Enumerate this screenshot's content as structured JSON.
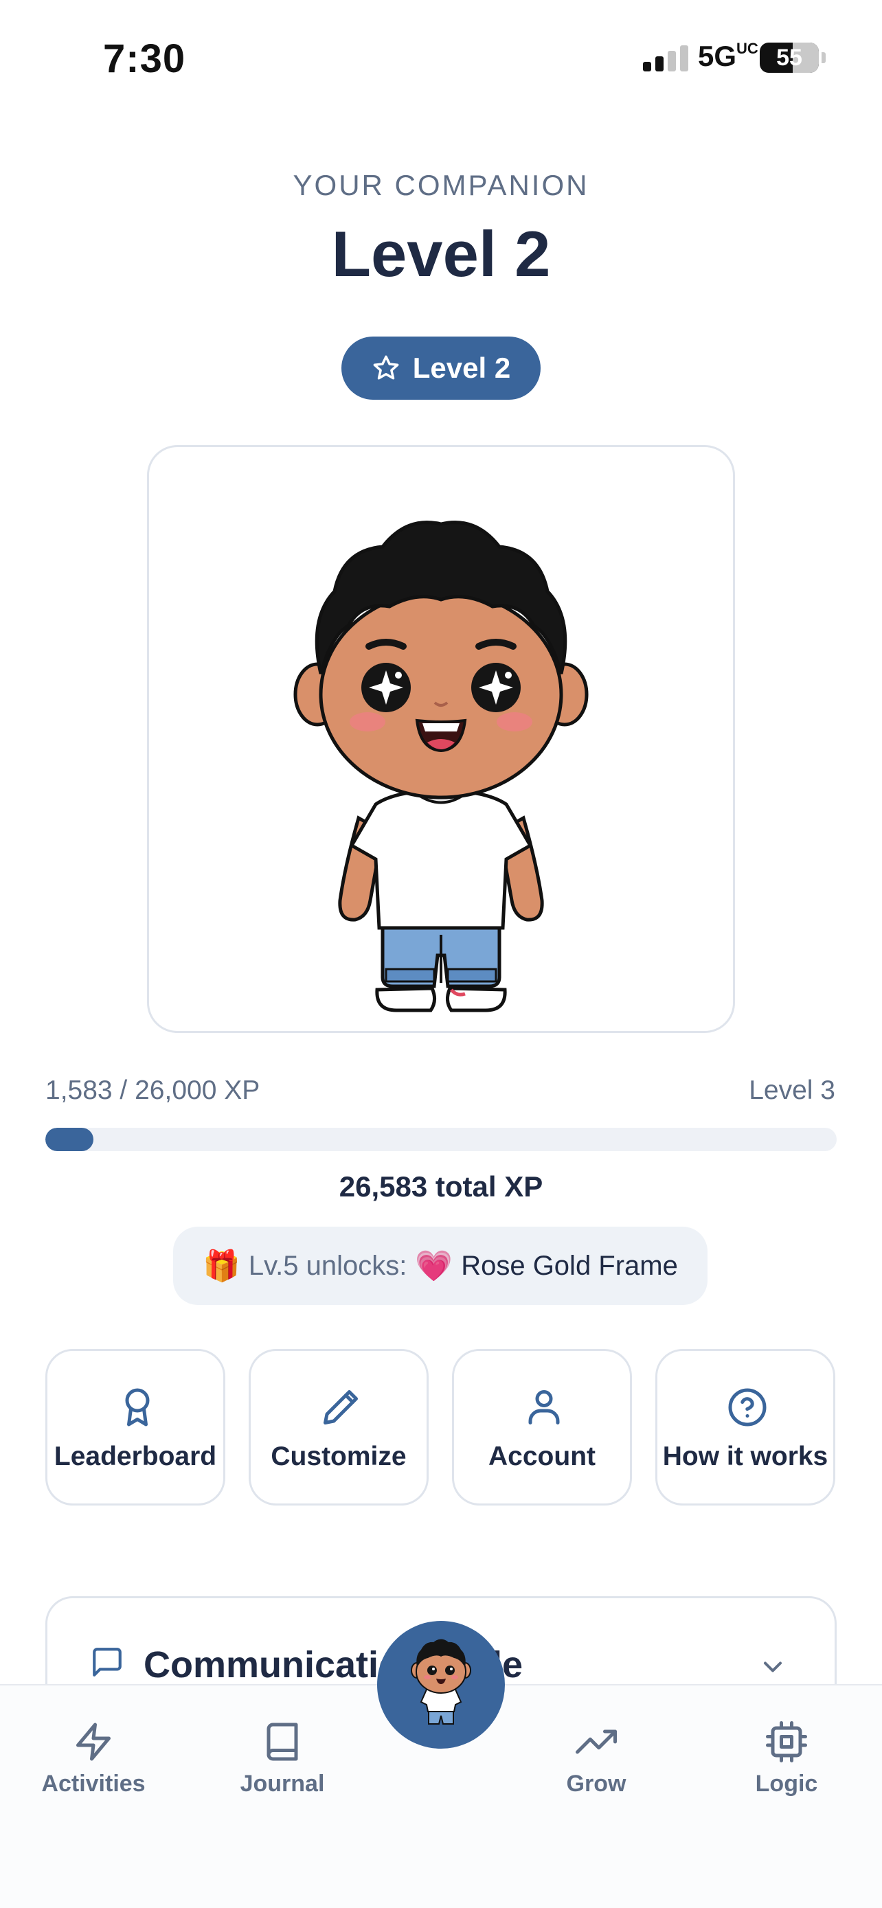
{
  "status_bar": {
    "time": "7:30",
    "network": "5G",
    "network_superscript": "UC",
    "battery_percent": "55"
  },
  "header": {
    "eyebrow": "YOUR COMPANION",
    "title": "Level 2",
    "level_badge": "Level 2"
  },
  "avatar": {
    "icon": "cartoon-boy-avatar"
  },
  "progress": {
    "current_label": "1,583 / 26,000 XP",
    "next_level_label": "Level 3",
    "fraction": 0.061,
    "total_label": "26,583 total XP"
  },
  "unlock": {
    "gift_emoji": "🎁",
    "label": "Lv.5 unlocks:",
    "heart_emoji": "💗",
    "reward": "Rose Gold Frame"
  },
  "actions": [
    {
      "label": "Leaderboard",
      "icon": "award-ribbon-icon"
    },
    {
      "label": "Customize",
      "icon": "pencil-icon"
    },
    {
      "label": "Account",
      "icon": "user-icon"
    },
    {
      "label": "How it works",
      "icon": "help-circle-icon"
    }
  ],
  "section": {
    "title": "Communication Style",
    "icon": "chat-bubble-icon"
  },
  "bottom_nav": [
    {
      "label": "Activities",
      "icon": "lightning-icon"
    },
    {
      "label": "Journal",
      "icon": "book-icon"
    },
    {
      "label": "Grow",
      "icon": "trending-up-icon"
    },
    {
      "label": "Logic",
      "icon": "chip-icon"
    }
  ],
  "colors": {
    "accent": "#3a659b",
    "text_primary": "#1f2a44",
    "text_secondary": "#5f6e86",
    "border": "#dfe4ec"
  }
}
